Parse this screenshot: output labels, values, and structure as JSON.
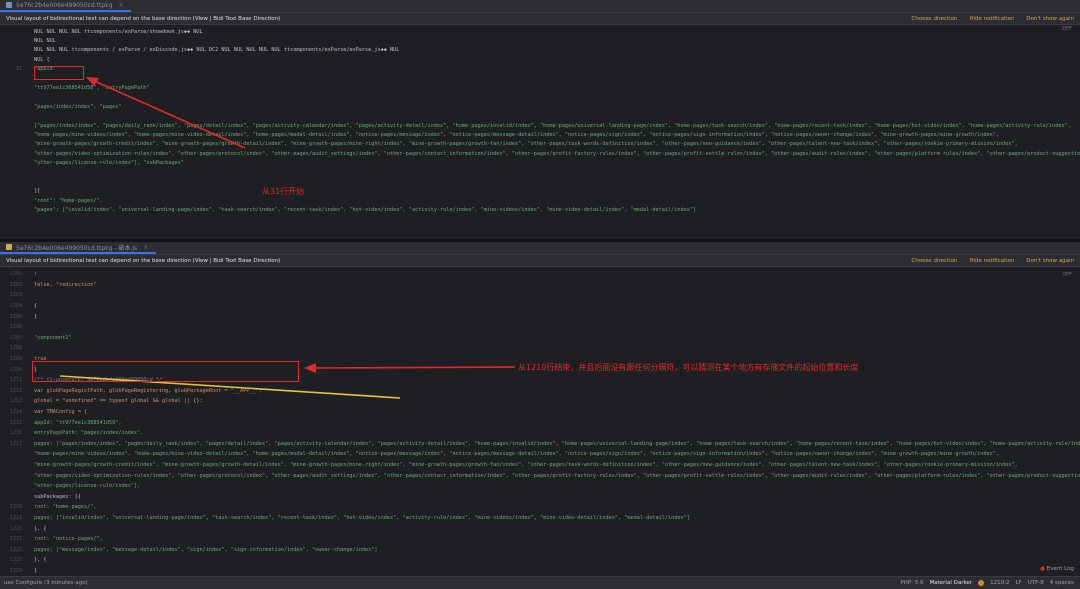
{
  "top": {
    "tab_label": "5e76c2b4e006e499050cd.ttpkg",
    "notification": {
      "message": "Visual layout of bidirectional text can depend on the base direction (View | Bidi Text Base Direction)",
      "actions": [
        "Choose direction",
        "Hide notification",
        "Don't show again"
      ]
    },
    "off_label": "OFF",
    "gutter": [
      "",
      "",
      "",
      "",
      "31",
      "",
      "",
      "",
      "",
      "",
      "",
      "",
      "",
      "",
      "",
      "",
      "",
      "",
      "",
      "",
      "",
      ""
    ],
    "lines": [
      "NUL NUL NUL NUL ttcomponents/exParse/showdown.js◆◆ NUL",
      "NUL NUL",
      "NUL NUL NUL ttcomponents / exParse / exDiscode.js◆◆ NUL DC2 NUL NUL NUL NUL NUL ttcomponents/exParse/exParse.js◆◆ NUL",
      "NUL {",
      "    \"appId\"",
      "",
      "    \"tt977ee1c368541d59\",  \"entryPagePath\"",
      "",
      "    \"pages/index/index\",  \"pages\"",
      "",
      "    [\"pages/index/index\", \"pages/daily_rank/index\", \"pages/detail/index\", \"pages/activity-calendar/index\", \"pages/activity-detail/index\", \"home-pages/invalid/index\", \"home-pages/universal-landing-page/index\", \"home-pages/task-search/index\", \"home-pages/recent-task/index\", \"home-pages/hot-video/index\", \"home-pages/activity-rule/index\",",
      "    \"home-pages/mine-videos/index\", \"home-pages/mine-video-detail/index\", \"home-pages/medal-detail/index\", \"notice-pages/message/index\", \"notice-pages/message-detail/index\", \"notice-pages/sign/index\", \"notice-pages/sign-information/index\", \"notice-pages/owner-change/index\", \"mine-growth-pages/mine-growth/index\",",
      "    \"mine-growth-pages/growth-credit/index\", \"mine-growth-pages/growth-detail/index\", \"mine-growth-pages/mine-right/index\", \"mine-growth-pages/growth-fan/index\", \"other-pages/task-words-definition/index\", \"other-pages/new-guidance/index\", \"other-pages/talent-new-task/index\", \"other-pages/rookie-primary-mission/index\",",
      "    \"other-pages/video-optimization-rules/index\", \"other-pages/protocol/index\", \"other-pages/audit_settings/index\", \"other-pages/contact_information/index\", \"other-pages/profit-factory-rules/index\", \"other-pages/profit-settle-rules/index\", \"other-pages/audit-rules/index\", \"other-pages/platform-rules/index\", \"other-pages/product-suggestions/index\",",
      "    \"other-pages/license-rule/index\"],  \"subPackages\"",
      "",
      "",
      "    [{",
      "        \"root\": \"home-pages/\",",
      "        \"pages\": [\"invalid/index\", \"universal-landing-page/index\", \"task-search/index\", \"recent-task/index\", \"hot-video/index\", \"activity-rule/index\", \"mine-videos/index\", \"mine-video-detail/index\", \"medal-detail/index\"]",
      "",
      ""
    ],
    "annotation": "从31行开始"
  },
  "bottom": {
    "tab_label": "5e76c2b4e006e499050cd.ttpkg - 副本.js",
    "notification": {
      "message": "Visual layout of bidirectional text can depend on the base direction (View | Bidi Text Base Direction)",
      "actions": [
        "Choose direction",
        "Hide notification",
        "Don't show again"
      ]
    },
    "off_label": "OFF",
    "gutter": [
      "1201",
      "1202",
      "1203",
      "1204",
      "1205",
      "1206",
      "1207",
      "1208",
      "1209",
      "1210",
      "1211",
      "1212",
      "1213",
      "1214",
      "1215",
      "1216",
      "1217",
      "",
      "",
      "",
      "",
      "",
      "1218",
      "1219",
      "1220",
      "1221",
      "1222",
      "1223",
      "1224"
    ],
    "lines": [
      "    :",
      "    false, \"redirection\"",
      "",
      "    {",
      "    }",
      "",
      "    \"component2\"",
      "",
      "    true",
      "}",
      "/** tt-unsecure: 5e76c2b4e006e499050cd */",
      "var globPageRegistPath, globPageRegistering, globPackageRoot = \"__APP__\";",
      "global = \"undefined\" == typeof global && global || {};",
      "var TMAConfig = {",
      "    appId: \"tt977ee1c368541d59\",",
      "    entryPagePath: \"pages/index/index\",",
      "    pages: [\"pages/index/index\", \"pages/daily_rank/index\", \"pages/detail/index\", \"pages/activity-calendar/index\", \"pages/activity-detail/index\", \"home-pages/invalid/index\", \"home-pages/universal-landing-page/index\", \"home-pages/task-search/index\", \"home-pages/recent-task/index\", \"home-pages/hot-video/index\", \"home-pages/activity-rule/index\",",
      "    \"home-pages/mine-videos/index\", \"home-pages/mine-video-detail/index\", \"home-pages/medal-detail/index\", \"notice-pages/message/index\", \"notice-pages/message-detail/index\", \"notice-pages/sign/index\", \"notice-pages/sign-information/index\", \"notice-pages/owner-change/index\", \"mine-growth-pages/mine-growth/index\",",
      "    \"mine-growth-pages/growth-credit/index\", \"mine-growth-pages/growth-detail/index\", \"mine-growth-pages/mine-right/index\", \"mine-growth-pages/growth-fan/index\", \"other-pages/task-words-definition/index\", \"other-pages/new-guidance/index\", \"other-pages/talent-new-task/index\", \"other-pages/rookie-primary-mission/index\",",
      "    \"other-pages/video-optimization-rules/index\", \"other-pages/protocol/index\", \"other-pages/audit_settings/index\", \"other-pages/contact_information/index\", \"other-pages/profit-factory-rules/index\", \"other-pages/profit-settle-rules/index\", \"other-pages/audit-rules/index\", \"other-pages/platform-rules/index\", \"other-pages/product-suggestions/index\",",
      "    \"other-pages/license-rule/index\"],",
      "    subPackages: [{",
      "        root: \"home-pages/\",",
      "        pages: [\"invalid/index\", \"universal-landing-page/index\", \"task-search/index\", \"recent-task/index\", \"hot-video/index\", \"activity-rule/index\", \"mine-videos/index\", \"mine-video-detail/index\", \"medal-detail/index\"]",
      "    }, {",
      "        root: \"notice-pages/\",",
      "        pages: [\"message/index\", \"message-detail/index\", \"sign/index\", \"sign-information/index\", \"owner-change/index\"]",
      "    }, {",
      "    }"
    ],
    "annotation": "从1210行结束，并且后面没有跟任何分隔符，可以猜测在某个地方有存储文件的起始位置和长度"
  },
  "status": {
    "left": "use    Configure (3 minutes ago)",
    "right": [
      "PHP: 5.6",
      "Material Darker",
      "1210:2",
      "LF",
      "UTF-8",
      "4 spaces"
    ],
    "event_log": "Event Log"
  }
}
